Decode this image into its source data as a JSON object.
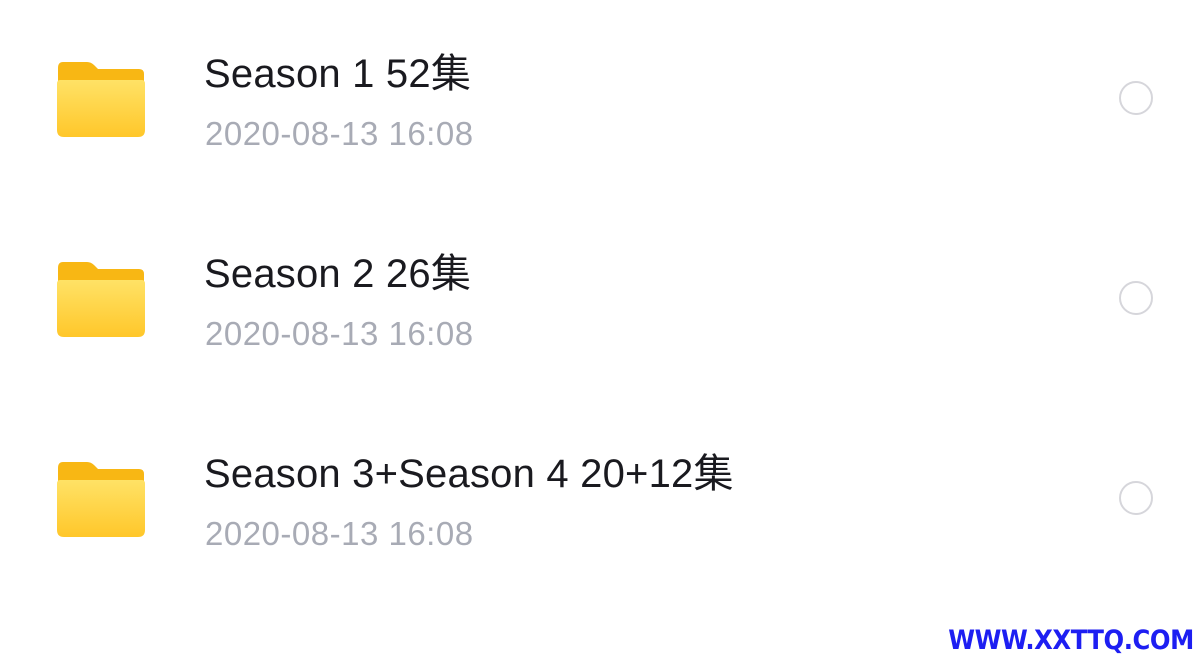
{
  "files": [
    {
      "name": "Season 1  52集",
      "date": "2020-08-13 16:08",
      "icon": "folder-icon",
      "selected": false
    },
    {
      "name": "Season 2 26集",
      "date": "2020-08-13 16:08",
      "icon": "folder-icon",
      "selected": false
    },
    {
      "name": "Season 3+Season 4 20+12集",
      "date": "2020-08-13 16:08",
      "icon": "folder-icon",
      "selected": false
    }
  ],
  "watermark": "WWW.XXTTQ.COM",
  "colors": {
    "folder_front": "#FFD23C",
    "folder_back": "#F8B714",
    "name_text": "#1A1A1F",
    "date_text": "#A8ABB5",
    "radio_border": "#D6D6DB",
    "watermark": "#1D1EF2"
  }
}
